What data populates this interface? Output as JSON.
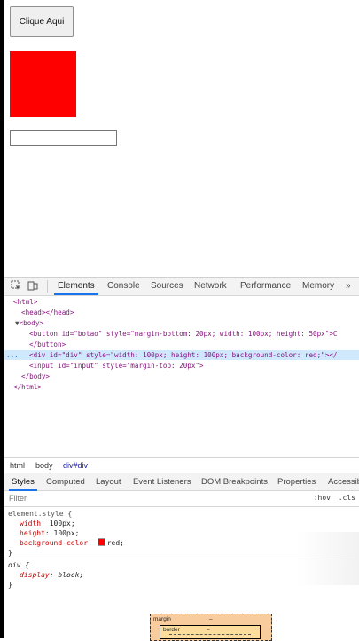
{
  "page": {
    "button_label": "Clique Aqui",
    "colors": {
      "box": "#ff0000"
    }
  },
  "devtools": {
    "tabs": [
      "Elements",
      "Console",
      "Sources",
      "Network",
      "Performance",
      "Memory"
    ],
    "more_icon": "»",
    "icons": [
      "inspect-icon",
      "device-toolbar-icon",
      "more-tabs-icon"
    ],
    "elements_lines": [
      "<html>",
      "<head></head>",
      "<body>",
      "<button id=\"botao\" style=\"margin-bottom: 20px; width: 100px; height: 50px\">C",
      "</button>",
      "<div id=\"div\" style=\"width: 100px; height: 100px; background-color: red;\"></",
      "<input id=\"input\" style=\"margin-top: 20px\">",
      "</body>",
      "</html>"
    ],
    "selected_marker": "...",
    "breadcrumbs": [
      "html",
      "body",
      "div#div"
    ],
    "styles_tabs": [
      "Styles",
      "Computed",
      "Layout",
      "Event Listeners",
      "DOM Breakpoints",
      "Properties",
      "Accessib"
    ],
    "filter_placeholder": "Filter",
    "hov": ":hov",
    "cls": ".cls",
    "element_style": {
      "selector": "element.style {",
      "props": [
        {
          "name": "width",
          "value": "100px;"
        },
        {
          "name": "height",
          "value": "100px;"
        },
        {
          "name": "background-color",
          "value": "red;"
        }
      ],
      "close": "}"
    },
    "div_rule": {
      "selector": "div {",
      "prop": "display",
      "value": "block;",
      "close": "}"
    },
    "box_model": {
      "margin_label": "margin",
      "margin_value": "–",
      "border_label": "border",
      "border_value": "–"
    }
  }
}
